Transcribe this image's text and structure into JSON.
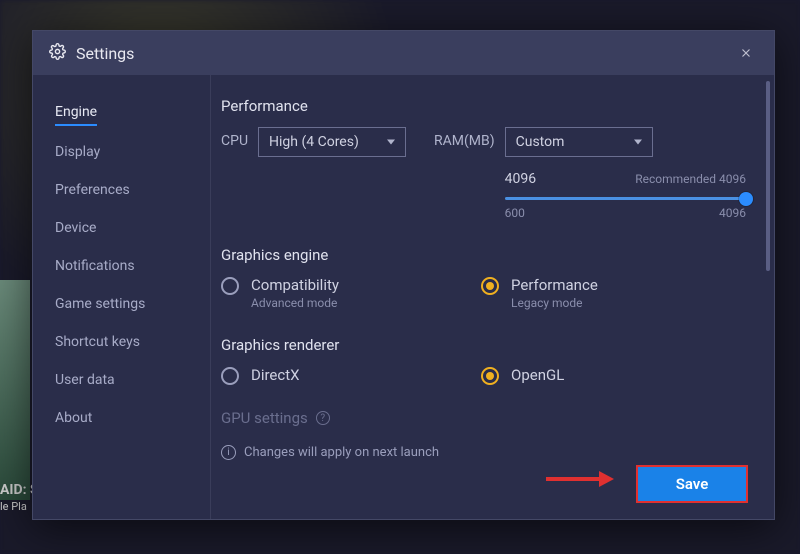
{
  "window": {
    "title": "Settings"
  },
  "sidebar": {
    "items": [
      {
        "label": "Engine",
        "active": true
      },
      {
        "label": "Display"
      },
      {
        "label": "Preferences"
      },
      {
        "label": "Device"
      },
      {
        "label": "Notifications"
      },
      {
        "label": "Game settings"
      },
      {
        "label": "Shortcut keys"
      },
      {
        "label": "User data"
      },
      {
        "label": "About"
      }
    ]
  },
  "performance": {
    "title": "Performance",
    "cpuLabel": "CPU",
    "cpuValue": "High (4 Cores)",
    "ramLabel": "RAM(MB)",
    "ramValue": "Custom",
    "ramCurrent": "4096",
    "ramRecommended": "Recommended 4096",
    "ramMin": "600",
    "ramMax": "4096"
  },
  "graphicsEngine": {
    "title": "Graphics engine",
    "options": [
      {
        "label": "Compatibility",
        "sub": "Advanced mode",
        "selected": false
      },
      {
        "label": "Performance",
        "sub": "Legacy mode",
        "selected": true
      }
    ]
  },
  "graphicsRenderer": {
    "title": "Graphics renderer",
    "options": [
      {
        "label": "DirectX",
        "selected": false
      },
      {
        "label": "OpenGL",
        "selected": true
      }
    ]
  },
  "gpu": {
    "title": "GPU settings"
  },
  "footer": {
    "note": "Changes will apply on next launch",
    "save": "Save"
  },
  "background": {
    "badge1": "AID: S",
    "badge2": "le Pla"
  }
}
